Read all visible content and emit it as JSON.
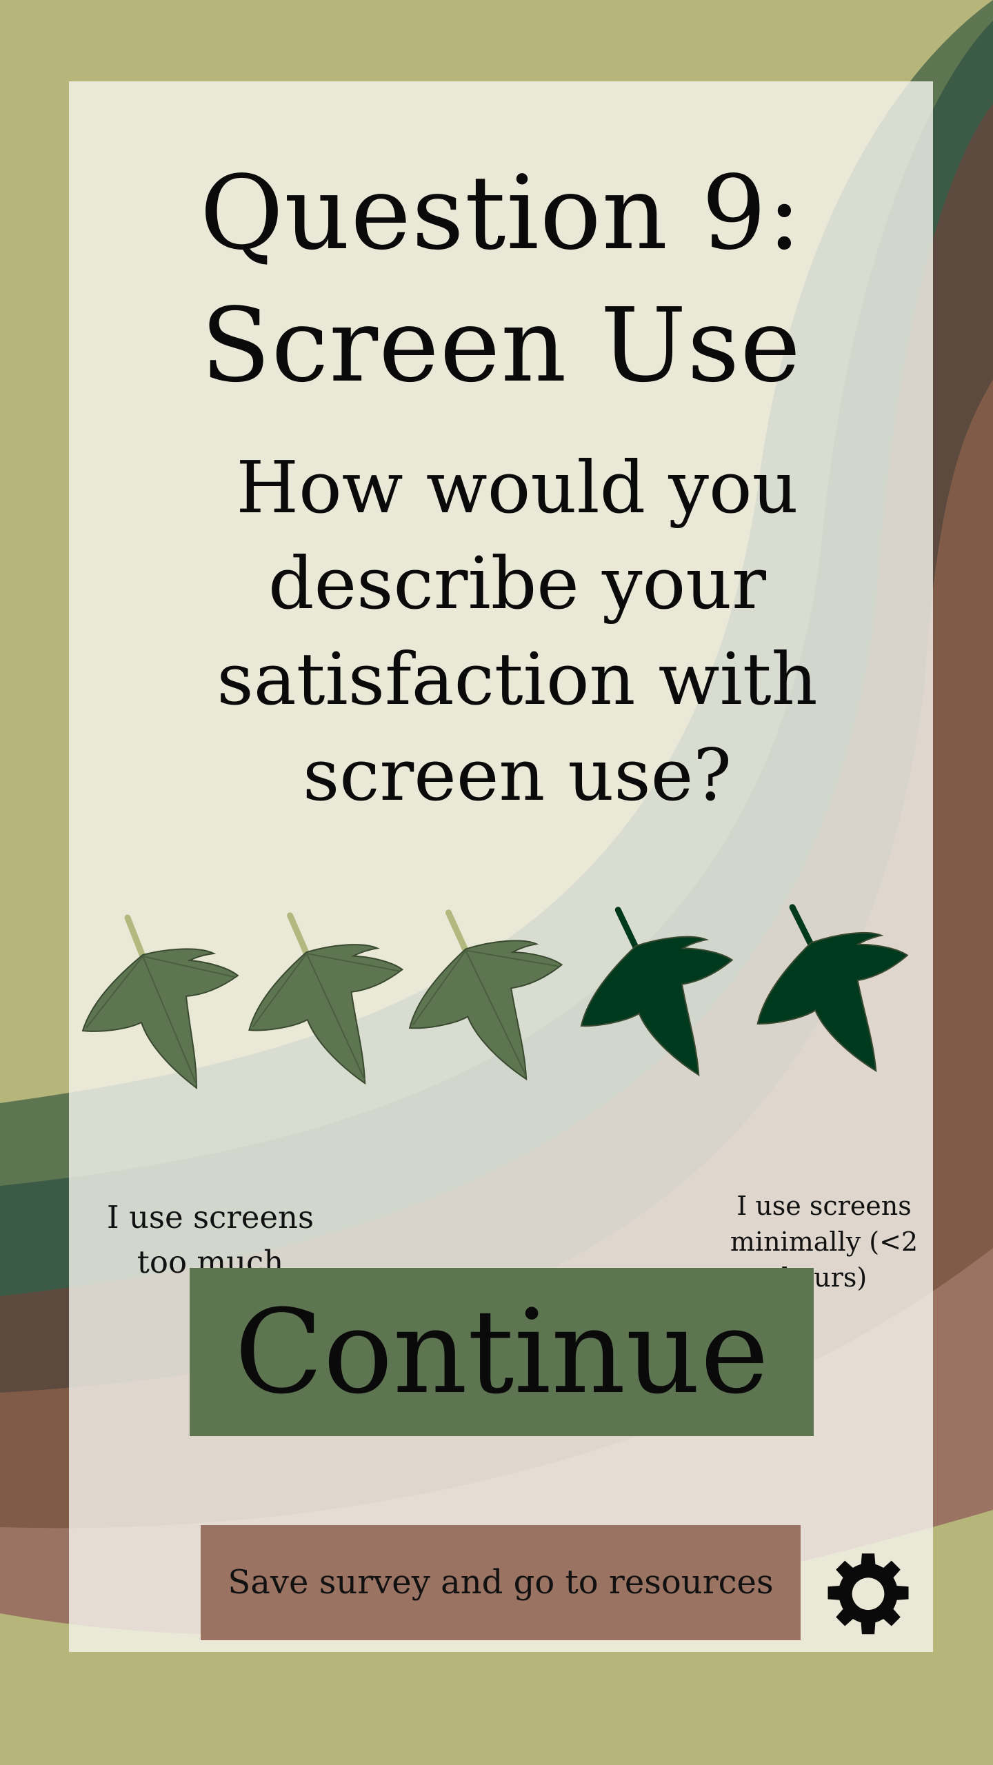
{
  "survey": {
    "title_line1": "Question 9:",
    "title_line2": "Screen Use",
    "question_lines": [
      "How would you",
      "describe your",
      "satisfaction with",
      "screen use?"
    ]
  },
  "rating": {
    "selected": 3,
    "max": 5,
    "label_left_lines": [
      "I use screens",
      "too much"
    ],
    "label_right_lines": [
      "I use screens",
      "minimally (<2",
      "hours)"
    ]
  },
  "buttons": {
    "continue_label": "Continue",
    "save_label": "Save survey and go to resources"
  },
  "icons": {
    "leaf": "maple-leaf-icon",
    "settings": "gear-icon"
  },
  "colors": {
    "background": "#b6b67b",
    "leaf_selected": "#5e7552",
    "leaf_unselected": "#003a1e",
    "continue_button": "#5e7552",
    "save_button": "#9a7362"
  }
}
